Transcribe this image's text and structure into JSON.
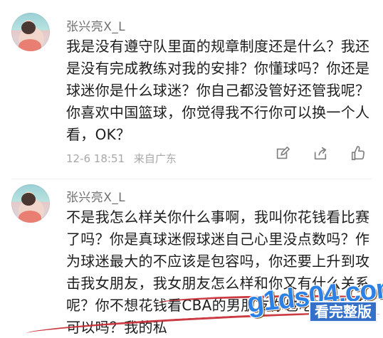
{
  "comments": [
    {
      "username": "张兴亮X_L",
      "text": "我是没有遵守队里面的规章制度还是什么？我还是没有完成教练对我的安排？你懂球吗？你还是球迷你是什么球迷？你自己都没管好还管我呢？你喜欢中国篮球，你觉得我不行你可以换一个人看，OK？",
      "date": "12-6 18:51",
      "location": "来自广东",
      "actions": [
        "edit-icon",
        "share-icon",
        "like-icon"
      ]
    },
    {
      "username": "张兴亮X_L",
      "text": "不是我怎么样关你什么事啊，我叫你花钱看比赛了吗？你是真球迷假球迷自己心里没点数吗？作为球迷最大的不应该是包容吗，你还要上升到攻击我女朋友，我女朋友怎么样和你又有什么关系呢？你不想花钱看CBA的男朋友你也吃这个红利可以吗？我的私"
    }
  ],
  "watermark": {
    "url": "g1ds04.com",
    "badge": "看完整版"
  },
  "colors": {
    "username": "#707070",
    "meta": "#a8a8a8",
    "underline": "#c62b34",
    "watermark_blue": "#3570c8"
  }
}
